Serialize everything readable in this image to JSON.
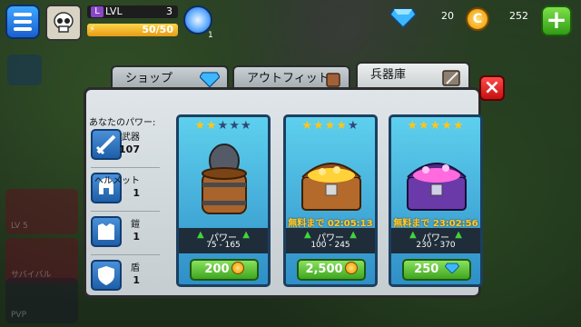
{
  "hud": {
    "level_label": "LVL",
    "level_badge": "L",
    "level": "3",
    "xp": 50,
    "xp_max": 50,
    "xp_text": "50/50",
    "swirl_count": "1",
    "gems": "20",
    "coins": "252",
    "coin_symbol": "C",
    "add_label": "+"
  },
  "sidebar": {
    "pvp_label": "PVP",
    "lv_label": "LV 5",
    "survival_label": "サバイバル",
    "lv3_label": "LV 3"
  },
  "tabs": [
    {
      "label": "ショップ",
      "icon": "gem-icon",
      "active": false
    },
    {
      "label": "アウトフィット",
      "icon": "outfit-icon",
      "active": false
    },
    {
      "label": "兵器庫",
      "icon": "armory-icon",
      "active": true
    }
  ],
  "panel": {
    "close_label": "×",
    "power_title": "あなたのパワー:",
    "stats": [
      {
        "label": "武器",
        "value": "107",
        "icon": "sword-icon"
      },
      {
        "label": "ヘルメット",
        "value": "1",
        "icon": "helmet-icon"
      },
      {
        "label": "鎧",
        "value": "1",
        "icon": "armor-icon"
      },
      {
        "label": "盾",
        "value": "1",
        "icon": "shield-icon"
      }
    ],
    "cards": [
      {
        "stars": 2,
        "max_stars": 5,
        "item": "barrel-icon",
        "free_text": "",
        "power_label": "パワー",
        "power_range": "75 - 165",
        "price": "200",
        "currency": "coin"
      },
      {
        "stars": 4,
        "max_stars": 5,
        "item": "gold-chest-icon",
        "free_text": "無料まで 02:05:13",
        "power_label": "パワー",
        "power_range": "100 - 245",
        "price": "2,500",
        "currency": "coin"
      },
      {
        "stars": 5,
        "max_stars": 5,
        "item": "purple-chest-icon",
        "free_text": "無料まで 23:02:56",
        "power_label": "パワー",
        "power_range": "230 - 370",
        "price": "250",
        "currency": "gem"
      }
    ]
  },
  "colors": {
    "accent_green": "#3ea51f",
    "close_red": "#c61010",
    "card_blue": "#2f8fc7",
    "star_gold": "#ffc51a",
    "timer_gold": "#ffcf2a"
  }
}
